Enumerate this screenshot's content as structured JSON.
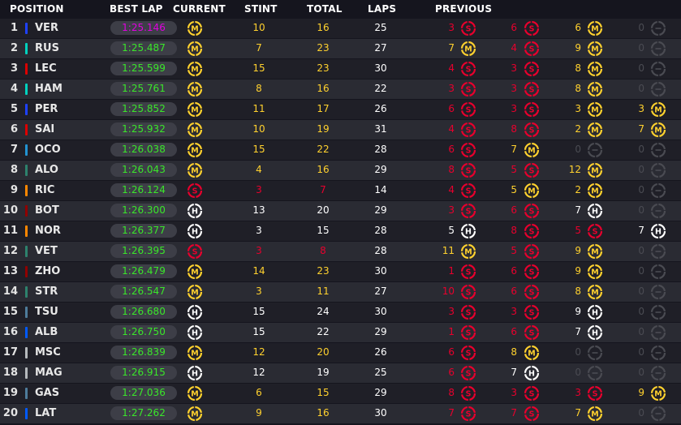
{
  "colors": {
    "soft": "#e8002d",
    "medium": "#ffd12e",
    "hard": "#ffffff",
    "unused": "#4a4b52",
    "fastest_lap": "#e000e0",
    "personal_lap": "#3ae62a"
  },
  "headers": {
    "position": "POSITION",
    "best_lap": "BEST LAP",
    "current": "CURRENT",
    "stint": "STINT",
    "total": "TOTAL",
    "laps": "LAPS",
    "previous": "PREVIOUS"
  },
  "rows": [
    {
      "pos": "1",
      "driver": "VER",
      "team_color": "#1e41ff",
      "best_lap": "1:25.146",
      "fastest": true,
      "current": "M",
      "stint": "10",
      "total": "16",
      "laps": "25",
      "prev": [
        {
          "n": "3",
          "t": "S"
        },
        {
          "n": "6",
          "t": "S"
        },
        {
          "n": "6",
          "t": "M"
        },
        {
          "n": "0",
          "t": "U"
        }
      ]
    },
    {
      "pos": "2",
      "driver": "RUS",
      "team_color": "#00d2be",
      "best_lap": "1:25.487",
      "fastest": false,
      "current": "M",
      "stint": "7",
      "total": "23",
      "laps": "27",
      "prev": [
        {
          "n": "7",
          "t": "M"
        },
        {
          "n": "4",
          "t": "S"
        },
        {
          "n": "9",
          "t": "M"
        },
        {
          "n": "0",
          "t": "U"
        }
      ]
    },
    {
      "pos": "3",
      "driver": "LEC",
      "team_color": "#dc0000",
      "best_lap": "1:25.599",
      "fastest": false,
      "current": "M",
      "stint": "15",
      "total": "23",
      "laps": "30",
      "prev": [
        {
          "n": "4",
          "t": "S"
        },
        {
          "n": "3",
          "t": "S"
        },
        {
          "n": "8",
          "t": "M"
        },
        {
          "n": "0",
          "t": "U"
        }
      ]
    },
    {
      "pos": "4",
      "driver": "HAM",
      "team_color": "#00d2be",
      "best_lap": "1:25.761",
      "fastest": false,
      "current": "M",
      "stint": "8",
      "total": "16",
      "laps": "22",
      "prev": [
        {
          "n": "3",
          "t": "S"
        },
        {
          "n": "3",
          "t": "S"
        },
        {
          "n": "8",
          "t": "M"
        },
        {
          "n": "0",
          "t": "U"
        }
      ]
    },
    {
      "pos": "5",
      "driver": "PER",
      "team_color": "#1e41ff",
      "best_lap": "1:25.852",
      "fastest": false,
      "current": "M",
      "stint": "11",
      "total": "17",
      "laps": "26",
      "prev": [
        {
          "n": "6",
          "t": "S"
        },
        {
          "n": "3",
          "t": "S"
        },
        {
          "n": "3",
          "t": "M"
        },
        {
          "n": "3",
          "t": "M"
        }
      ]
    },
    {
      "pos": "6",
      "driver": "SAI",
      "team_color": "#dc0000",
      "best_lap": "1:25.932",
      "fastest": false,
      "current": "M",
      "stint": "10",
      "total": "19",
      "laps": "31",
      "prev": [
        {
          "n": "4",
          "t": "S"
        },
        {
          "n": "8",
          "t": "S"
        },
        {
          "n": "2",
          "t": "M"
        },
        {
          "n": "7",
          "t": "M"
        }
      ]
    },
    {
      "pos": "7",
      "driver": "OCO",
      "team_color": "#2293d1",
      "best_lap": "1:26.038",
      "fastest": false,
      "current": "M",
      "stint": "15",
      "total": "22",
      "laps": "28",
      "prev": [
        {
          "n": "6",
          "t": "S"
        },
        {
          "n": "7",
          "t": "M"
        },
        {
          "n": "0",
          "t": "U"
        },
        {
          "n": "0",
          "t": "U"
        }
      ]
    },
    {
      "pos": "8",
      "driver": "ALO",
      "team_color": "#2d826d",
      "best_lap": "1:26.043",
      "fastest": false,
      "current": "M",
      "stint": "4",
      "total": "16",
      "laps": "29",
      "prev": [
        {
          "n": "8",
          "t": "S"
        },
        {
          "n": "5",
          "t": "S"
        },
        {
          "n": "12",
          "t": "M"
        },
        {
          "n": "0",
          "t": "U"
        }
      ]
    },
    {
      "pos": "9",
      "driver": "RIC",
      "team_color": "#ff8700",
      "best_lap": "1:26.124",
      "fastest": false,
      "current": "S",
      "stint": "3",
      "total": "7",
      "laps": "14",
      "prev": [
        {
          "n": "4",
          "t": "S"
        },
        {
          "n": "5",
          "t": "M"
        },
        {
          "n": "2",
          "t": "M"
        },
        {
          "n": "0",
          "t": "U"
        }
      ]
    },
    {
      "pos": "10",
      "driver": "BOT",
      "team_color": "#900000",
      "best_lap": "1:26.300",
      "fastest": false,
      "current": "H",
      "stint": "13",
      "total": "20",
      "laps": "29",
      "prev": [
        {
          "n": "3",
          "t": "S"
        },
        {
          "n": "6",
          "t": "S"
        },
        {
          "n": "7",
          "t": "H"
        },
        {
          "n": "0",
          "t": "U"
        }
      ]
    },
    {
      "pos": "11",
      "driver": "NOR",
      "team_color": "#ff8700",
      "best_lap": "1:26.377",
      "fastest": false,
      "current": "H",
      "stint": "3",
      "total": "15",
      "laps": "28",
      "prev": [
        {
          "n": "5",
          "t": "H"
        },
        {
          "n": "8",
          "t": "S"
        },
        {
          "n": "5",
          "t": "S"
        },
        {
          "n": "7",
          "t": "H"
        }
      ]
    },
    {
      "pos": "12",
      "driver": "VET",
      "team_color": "#2d826d",
      "best_lap": "1:26.395",
      "fastest": false,
      "current": "S",
      "stint": "3",
      "total": "8",
      "laps": "28",
      "prev": [
        {
          "n": "11",
          "t": "M"
        },
        {
          "n": "5",
          "t": "S"
        },
        {
          "n": "9",
          "t": "M"
        },
        {
          "n": "0",
          "t": "U"
        }
      ]
    },
    {
      "pos": "13",
      "driver": "ZHO",
      "team_color": "#900000",
      "best_lap": "1:26.479",
      "fastest": false,
      "current": "M",
      "stint": "14",
      "total": "23",
      "laps": "30",
      "prev": [
        {
          "n": "1",
          "t": "S"
        },
        {
          "n": "6",
          "t": "S"
        },
        {
          "n": "9",
          "t": "M"
        },
        {
          "n": "0",
          "t": "U"
        }
      ]
    },
    {
      "pos": "14",
      "driver": "STR",
      "team_color": "#2d826d",
      "best_lap": "1:26.547",
      "fastest": false,
      "current": "M",
      "stint": "3",
      "total": "11",
      "laps": "27",
      "prev": [
        {
          "n": "10",
          "t": "S"
        },
        {
          "n": "6",
          "t": "S"
        },
        {
          "n": "8",
          "t": "M"
        },
        {
          "n": "0",
          "t": "U"
        }
      ]
    },
    {
      "pos": "15",
      "driver": "TSU",
      "team_color": "#4e7c9b",
      "best_lap": "1:26.680",
      "fastest": false,
      "current": "H",
      "stint": "15",
      "total": "24",
      "laps": "30",
      "prev": [
        {
          "n": "3",
          "t": "S"
        },
        {
          "n": "3",
          "t": "S"
        },
        {
          "n": "9",
          "t": "H"
        },
        {
          "n": "0",
          "t": "U"
        }
      ]
    },
    {
      "pos": "16",
      "driver": "ALB",
      "team_color": "#005aff",
      "best_lap": "1:26.750",
      "fastest": false,
      "current": "H",
      "stint": "15",
      "total": "22",
      "laps": "29",
      "prev": [
        {
          "n": "1",
          "t": "S"
        },
        {
          "n": "6",
          "t": "S"
        },
        {
          "n": "7",
          "t": "H"
        },
        {
          "n": "0",
          "t": "U"
        }
      ]
    },
    {
      "pos": "17",
      "driver": "MSC",
      "team_color": "#b6babd",
      "best_lap": "1:26.839",
      "fastest": false,
      "current": "M",
      "stint": "12",
      "total": "20",
      "laps": "26",
      "prev": [
        {
          "n": "6",
          "t": "S"
        },
        {
          "n": "8",
          "t": "M"
        },
        {
          "n": "0",
          "t": "U"
        },
        {
          "n": "0",
          "t": "U"
        }
      ]
    },
    {
      "pos": "18",
      "driver": "MAG",
      "team_color": "#b6babd",
      "best_lap": "1:26.915",
      "fastest": false,
      "current": "H",
      "stint": "12",
      "total": "19",
      "laps": "25",
      "prev": [
        {
          "n": "6",
          "t": "S"
        },
        {
          "n": "7",
          "t": "H"
        },
        {
          "n": "0",
          "t": "U"
        },
        {
          "n": "0",
          "t": "U"
        }
      ]
    },
    {
      "pos": "19",
      "driver": "GAS",
      "team_color": "#4e7c9b",
      "best_lap": "1:27.036",
      "fastest": false,
      "current": "M",
      "stint": "6",
      "total": "15",
      "laps": "29",
      "prev": [
        {
          "n": "8",
          "t": "S"
        },
        {
          "n": "3",
          "t": "S"
        },
        {
          "n": "3",
          "t": "S"
        },
        {
          "n": "9",
          "t": "M"
        }
      ]
    },
    {
      "pos": "20",
      "driver": "LAT",
      "team_color": "#005aff",
      "best_lap": "1:27.262",
      "fastest": false,
      "current": "M",
      "stint": "9",
      "total": "16",
      "laps": "30",
      "prev": [
        {
          "n": "7",
          "t": "S"
        },
        {
          "n": "7",
          "t": "S"
        },
        {
          "n": "7",
          "t": "M"
        },
        {
          "n": "0",
          "t": "U"
        }
      ]
    }
  ]
}
